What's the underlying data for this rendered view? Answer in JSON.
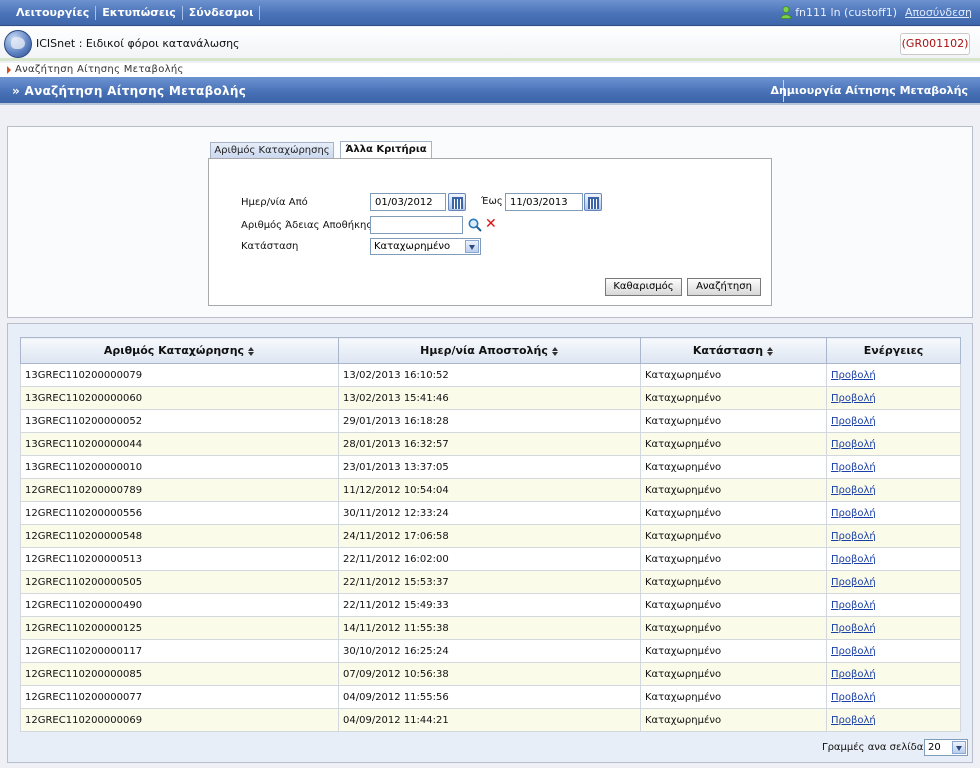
{
  "topmenu": {
    "items": [
      "Λειτουργίες",
      "Εκτυπώσεις",
      "Σύνδεσμοι"
    ]
  },
  "user": {
    "name": "fn111 ln (custoff1)",
    "logout": "Αποσύνδεση"
  },
  "app": {
    "title": "ICISnet : Ειδικοί φόροι κατανάλωσης",
    "code": "(GR001102)"
  },
  "breadcrumb": "Αναζήτηση Αίτησης Μεταβολής",
  "page": {
    "title": "» Αναζήτηση Αίτησης Μεταβολής",
    "create_link": "Δημιουργία Αίτησης Μεταβολής"
  },
  "tabs": [
    "Αριθμός Καταχώρησης",
    "Άλλα Κριτήρια"
  ],
  "form": {
    "date_from_label": "Ημερ/νία Από",
    "date_from": "01/03/2012",
    "date_to_label": "Έως",
    "date_to": "11/03/2013",
    "permit_label": "Αριθμός Άδειας Αποθήκης",
    "permit_value": "",
    "status_label": "Κατάσταση",
    "status_value": "Καταχωρημένο",
    "clear_btn": "Καθαρισμός",
    "search_btn": "Αναζήτηση"
  },
  "table": {
    "headers": [
      "Αριθμός Καταχώρησης",
      "Ημερ/νία Αποστολής",
      "Κατάσταση",
      "Ενέργειες"
    ],
    "rows": [
      [
        "13GREC110200000079",
        "13/02/2013 16:10:52",
        "Καταχωρημένο",
        "Προβολή"
      ],
      [
        "13GREC110200000060",
        "13/02/2013 15:41:46",
        "Καταχωρημένο",
        "Προβολή"
      ],
      [
        "13GREC110200000052",
        "29/01/2013 16:18:28",
        "Καταχωρημένο",
        "Προβολή"
      ],
      [
        "13GREC110200000044",
        "28/01/2013 16:32:57",
        "Καταχωρημένο",
        "Προβολή"
      ],
      [
        "13GREC110200000010",
        "23/01/2013 13:37:05",
        "Καταχωρημένο",
        "Προβολή"
      ],
      [
        "12GREC110200000789",
        "11/12/2012 10:54:04",
        "Καταχωρημένο",
        "Προβολή"
      ],
      [
        "12GREC110200000556",
        "30/11/2012 12:33:24",
        "Καταχωρημένο",
        "Προβολή"
      ],
      [
        "12GREC110200000548",
        "24/11/2012 17:06:58",
        "Καταχωρημένο",
        "Προβολή"
      ],
      [
        "12GREC110200000513",
        "22/11/2012 16:02:00",
        "Καταχωρημένο",
        "Προβολή"
      ],
      [
        "12GREC110200000505",
        "22/11/2012 15:53:37",
        "Καταχωρημένο",
        "Προβολή"
      ],
      [
        "12GREC110200000490",
        "22/11/2012 15:49:33",
        "Καταχωρημένο",
        "Προβολή"
      ],
      [
        "12GREC110200000125",
        "14/11/2012 11:55:38",
        "Καταχωρημένο",
        "Προβολή"
      ],
      [
        "12GREC110200000117",
        "30/10/2012 16:25:24",
        "Καταχωρημένο",
        "Προβολή"
      ],
      [
        "12GREC110200000085",
        "07/09/2012 10:56:38",
        "Καταχωρημένο",
        "Προβολή"
      ],
      [
        "12GREC110200000077",
        "04/09/2012 11:55:56",
        "Καταχωρημένο",
        "Προβολή"
      ],
      [
        "12GREC110200000069",
        "04/09/2012 11:44:21",
        "Καταχωρημένο",
        "Προβολή"
      ]
    ]
  },
  "pager": {
    "label": "Γραμμές ανα σελίδα:",
    "value": "20"
  },
  "icons": {
    "user": "user-icon",
    "globe": "globe-logo-icon",
    "calendar": "calendar-icon",
    "search": "magnifier-icon",
    "clear": "clear-x-icon",
    "sort": "sort-arrows-icon"
  },
  "colors": {
    "header_blue": "#4670b5",
    "link": "#1a3fa6",
    "code_red": "#a11111",
    "alt_row": "#fbfbea"
  }
}
